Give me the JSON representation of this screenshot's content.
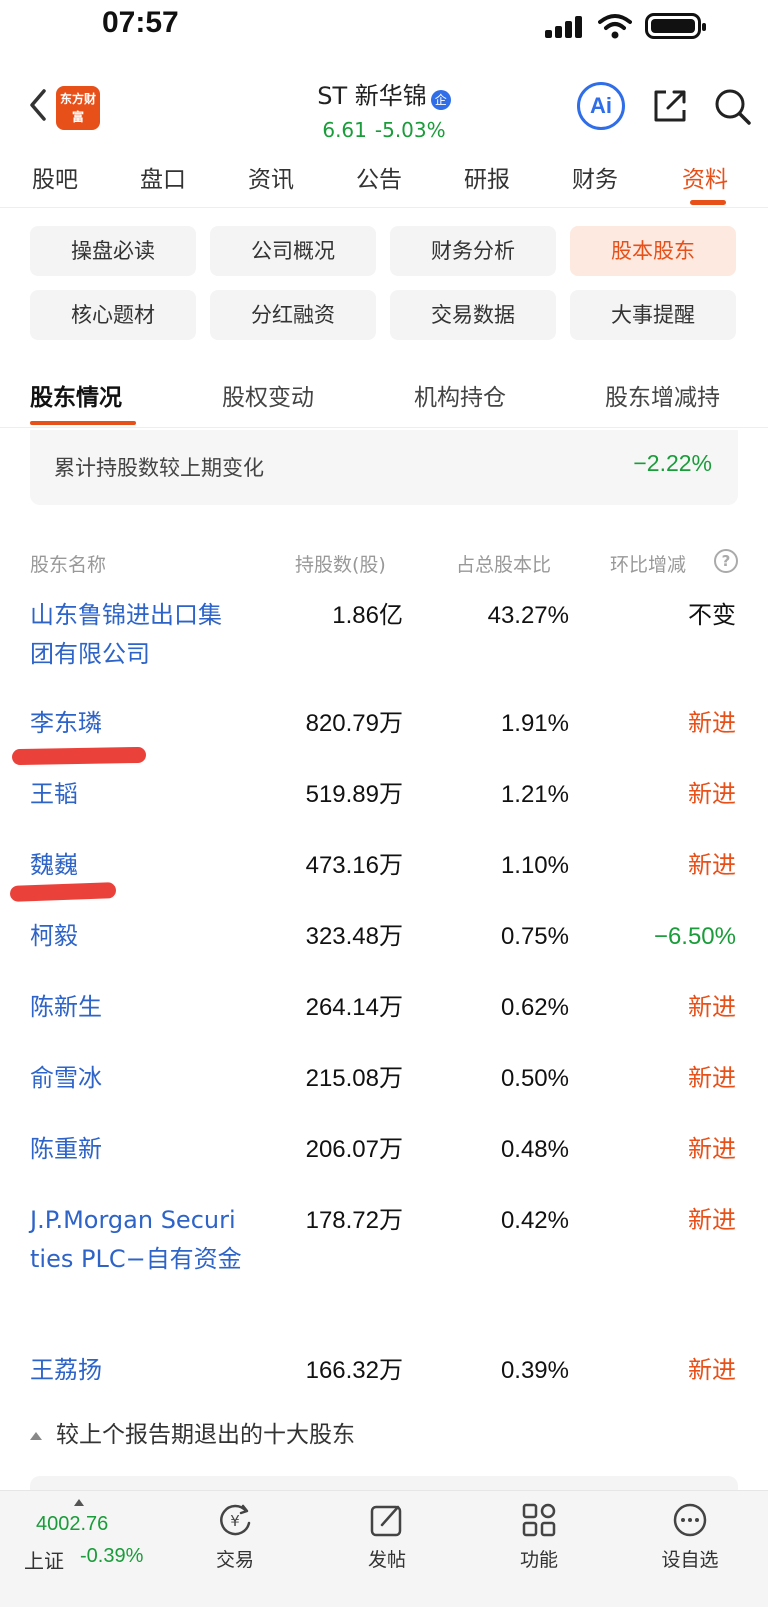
{
  "status_bar": {
    "time": "07:57"
  },
  "header": {
    "app_logo_text": "东方财富",
    "stock_name": "ST 新华锦",
    "badge": "企",
    "price": "6.61",
    "change_pct": "-5.03%",
    "ai_label": "Ai"
  },
  "main_tabs": [
    "股吧",
    "盘口",
    "资讯",
    "公告",
    "研报",
    "财务",
    "资料"
  ],
  "grid_buttons": [
    "操盘必读",
    "公司概况",
    "财务分析",
    "股本股东",
    "核心题材",
    "分红融资",
    "交易数据",
    "大事提醒"
  ],
  "sub_tabs": [
    "股东情况",
    "股权变动",
    "机构持仓",
    "股东增减持"
  ],
  "summary": {
    "label": "累计持股数较上期变化",
    "value": "−2.22%"
  },
  "table": {
    "headers": {
      "name": "股东名称",
      "shares": "持股数(股)",
      "ratio": "占总股本比",
      "change": "环比增减"
    },
    "rows": [
      {
        "name": "山东鲁锦进出口集团有限公司",
        "shares": "1.86亿",
        "ratio": "43.27%",
        "change": "不变"
      },
      {
        "name": "李东璘",
        "shares": "820.79万",
        "ratio": "1.91%",
        "change": "新进"
      },
      {
        "name": "王韬",
        "shares": "519.89万",
        "ratio": "1.21%",
        "change": "新进"
      },
      {
        "name": "魏巍",
        "shares": "473.16万",
        "ratio": "1.10%",
        "change": "新进"
      },
      {
        "name": "柯毅",
        "shares": "323.48万",
        "ratio": "0.75%",
        "change": "−6.50%"
      },
      {
        "name": "陈新生",
        "shares": "264.14万",
        "ratio": "0.62%",
        "change": "新进"
      },
      {
        "name": "俞雪冰",
        "shares": "215.08万",
        "ratio": "0.50%",
        "change": "新进"
      },
      {
        "name": "陈重新",
        "shares": "206.07万",
        "ratio": "0.48%",
        "change": "新进"
      },
      {
        "name": "J.P.Morgan Securities PLC−自有资金",
        "shares": "178.72万",
        "ratio": "0.42%",
        "change": "新进"
      },
      {
        "name": "王荔扬",
        "shares": "166.32万",
        "ratio": "0.39%",
        "change": "新进"
      }
    ]
  },
  "collapse_label": "较上个报告期退出的十大股东",
  "bottom_bar": {
    "index_value": "4002.76",
    "index_name": "上证",
    "index_change": "-0.39%",
    "nav": [
      "交易",
      "发帖",
      "功能",
      "设自选"
    ]
  },
  "colors": {
    "accent": "#e8501a",
    "down_green": "#1a9c3a",
    "link_blue": "#2e64c8",
    "annotation_red": "#e8322a"
  }
}
